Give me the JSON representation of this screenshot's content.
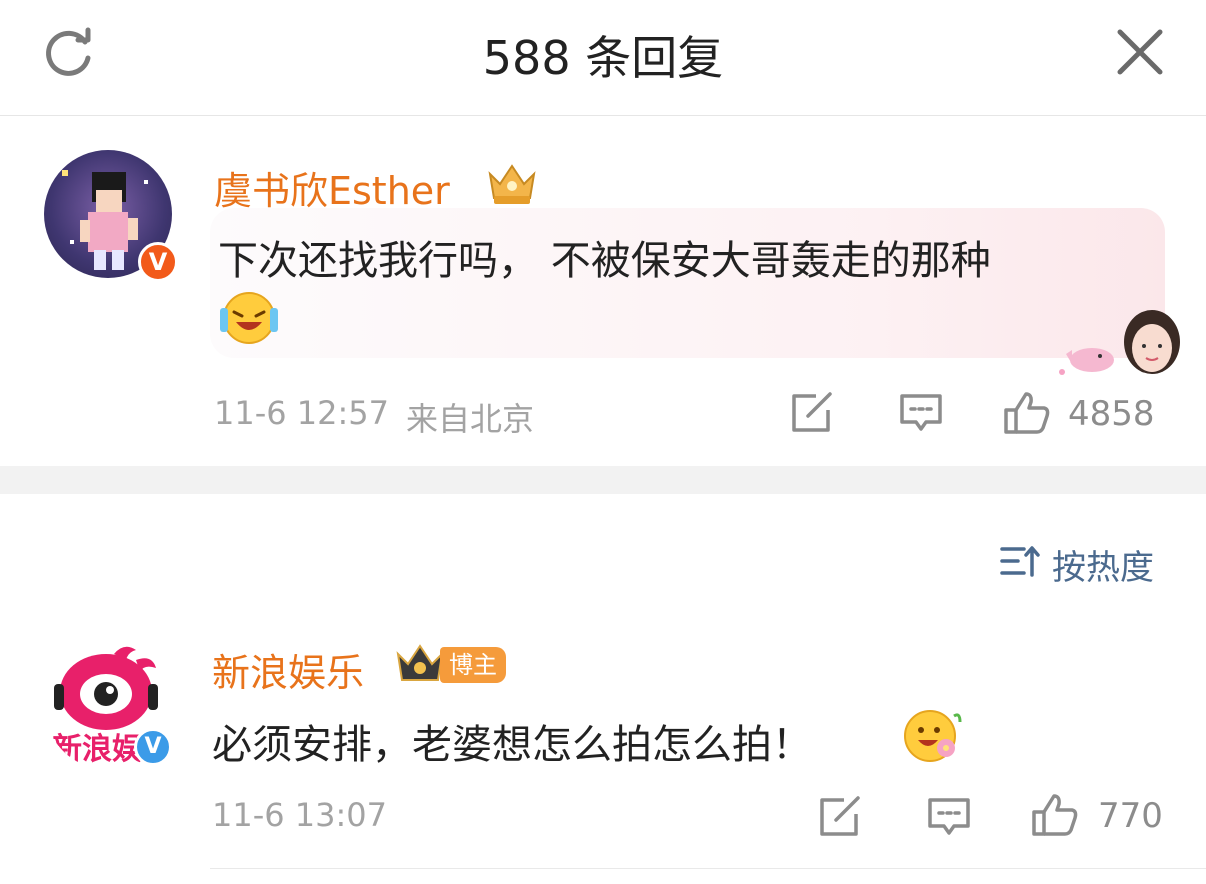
{
  "header": {
    "title": "588 条回复"
  },
  "comment": {
    "username": "虞书欣Esther",
    "text_line1": "下次还找我行吗， 不被保安大哥轰走的那种",
    "timestamp": "11-6 12:57",
    "location": "来自北京",
    "likes": "4858",
    "badge": "V",
    "emoji": "laughing-crying-emoji"
  },
  "sort": {
    "label": "按热度"
  },
  "reply": {
    "username": "新浪娱乐",
    "tag": "博主",
    "text": "必须安排，老婆想怎么拍怎么拍！",
    "timestamp": "11-6 13:07",
    "likes": "770",
    "avatar_text": "新浪娱",
    "badge": "V"
  },
  "colors": {
    "username": "#e8731b",
    "icon_gray": "#8c8c8c",
    "sort_blue": "#4b6a8e",
    "badge_orange": "#f59b3b"
  }
}
